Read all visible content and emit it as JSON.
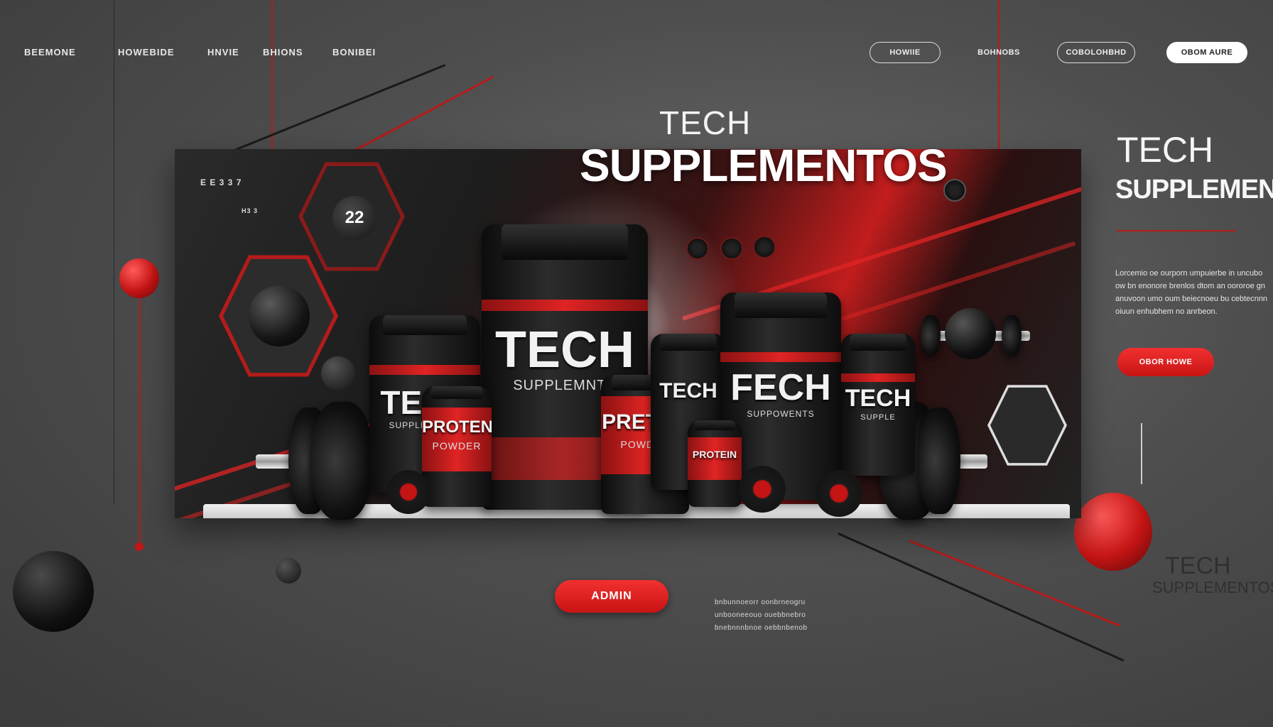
{
  "nav": {
    "links": [
      "BEEMONE",
      "HOWEBIDE",
      "HNVIE",
      "BHIONS",
      "BONIBEI"
    ],
    "pills": [
      "HOWIIE",
      "BOHNOBS",
      "COBOLOHBHD",
      "OBOM AURE"
    ]
  },
  "hero": {
    "title_small": "TECH",
    "title_big": "SUPPLEMENTOS",
    "badge_number": "22",
    "corner_code": "E E 3 3 7",
    "corner_code_2": "H3 3",
    "tubs": [
      {
        "label": "TECH",
        "sub": "SUPPLEMNNTS"
      },
      {
        "label": "TECH",
        "sub": "SUPPLEMNTS"
      },
      {
        "label": "PROTEN",
        "sub": "POWDER"
      },
      {
        "label": "PRETEN",
        "sub": "POWDER"
      },
      {
        "label": "TECH",
        "sub": ""
      },
      {
        "label": "FECH",
        "sub": "SUPPOWENTS"
      },
      {
        "label": "TECH",
        "sub": "SUPPLE"
      },
      {
        "label": "PROTEIN",
        "sub": ""
      }
    ]
  },
  "buttons": {
    "admin": "ADMIN",
    "side_cta": "OBOR HOWE"
  },
  "side": {
    "title": "TECH",
    "subtitle": "SUPPLEMENTOS",
    "text": "Lorcemio oe ourporn umpuierbe in uncubo ow bn enonore brenlos dtom an oororoe gn anuvoon umo oum beiecnoeu bu cebtecnnn oiuun enhubhem no anrbeon."
  },
  "footer_text": {
    "lines": [
      "bnbunnoeorr oonbrneogru",
      "unbooneeouo ouebbnebro",
      "bnebnnnbnoe oebbnbenob"
    ]
  },
  "watermark": {
    "line1": "TECH",
    "line2": "SUPPLEMENTOS"
  },
  "colors": {
    "accent": "#e02424",
    "background": "#4e4e4e",
    "panel": "#1d1d1d"
  }
}
